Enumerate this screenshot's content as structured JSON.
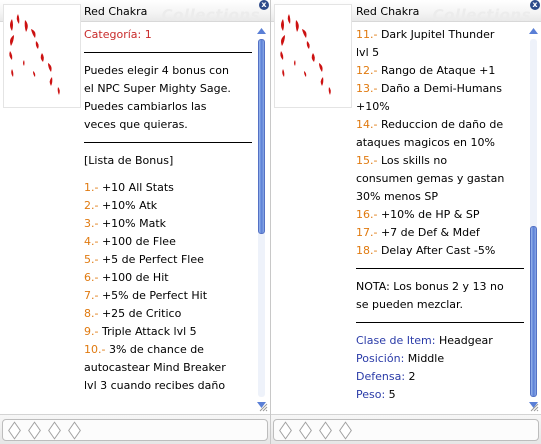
{
  "window_left": {
    "title": "Red Chakra",
    "watermark": "Collections",
    "close": "x",
    "lines": [
      {
        "text": "Categoría: 1",
        "cls": "red"
      },
      {
        "sep": true
      },
      {
        "text": "Puedes elegir 4 bonus con"
      },
      {
        "text": "el NPC Super Mighty Sage."
      },
      {
        "text": "Puedes cambiarlos las"
      },
      {
        "text": "veces que quieras."
      },
      {
        "sep": true
      },
      {
        "text": "[Lista de Bonus]"
      },
      {
        "gap": true
      },
      {
        "num": "1.-",
        "text": " +10 All Stats"
      },
      {
        "num": "2.-",
        "text": " +10% Atk"
      },
      {
        "num": "3.-",
        "text": " +10% Matk"
      },
      {
        "num": "4.-",
        "text": " +100 de Flee"
      },
      {
        "num": "5.-",
        "text": " +5 de Perfect Flee"
      },
      {
        "num": "6.-",
        "text": " +100 de Hit"
      },
      {
        "num": "7.-",
        "text": " +5% de Perfect Hit"
      },
      {
        "num": "8.-",
        "text": " +25 de Critico"
      },
      {
        "num": "9.-",
        "text": " Triple Attack lvl 5"
      },
      {
        "num": "10.-",
        "text": " 3% de chance de"
      },
      {
        "text": "autocastear Mind Breaker"
      },
      {
        "text": "lvl 3 cuando recibes daño"
      }
    ],
    "scroll_fraction": 0.0
  },
  "window_right": {
    "title": "Red Chakra",
    "watermark": "Collections",
    "close": "x",
    "lines": [
      {
        "num": "11.-",
        "text": " Dark Jupitel Thunder"
      },
      {
        "text": "lvl 5"
      },
      {
        "num": "12.-",
        "text": " Rango de Ataque +1"
      },
      {
        "num": "13.-",
        "text": " Daño a Demi-Humans"
      },
      {
        "text": "+10%"
      },
      {
        "num": "14.-",
        "text": " Reduccion de daño de"
      },
      {
        "text": "ataques magicos en 10%"
      },
      {
        "num": "15.-",
        "text": " Los skills no"
      },
      {
        "text": "consumen gemas y gastan"
      },
      {
        "text": "30% menos SP"
      },
      {
        "num": "16.-",
        "text": " +10% de HP & SP"
      },
      {
        "num": "17.-",
        "text": " +7 de Def & Mdef"
      },
      {
        "num": "18.-",
        "text": " Delay After Cast -5%"
      },
      {
        "sep": true
      },
      {
        "text": "NOTA: Los bonus 2 y 13 no"
      },
      {
        "text": "se pueden mezclar."
      },
      {
        "sep": true
      },
      {
        "label": "Clase de Item:",
        "text": " Headgear"
      },
      {
        "label": "Posición:",
        "text": " Middle"
      },
      {
        "label": "Defensa:",
        "text": " 2"
      },
      {
        "label": "Peso:",
        "text": " 5"
      }
    ],
    "scroll_fraction": 1.0
  },
  "icon_names": [
    "close-icon",
    "scroll-up-arrow-icon",
    "scroll-down-arrow-icon",
    "resize-grip-icon",
    "card-slot-icon",
    "item-illustration"
  ],
  "colors": {
    "category": "#c82a2a",
    "bonus_number": "#e07a10",
    "property_label": "#2a3ba8",
    "scroll_thumb": "#5a7fd6"
  }
}
